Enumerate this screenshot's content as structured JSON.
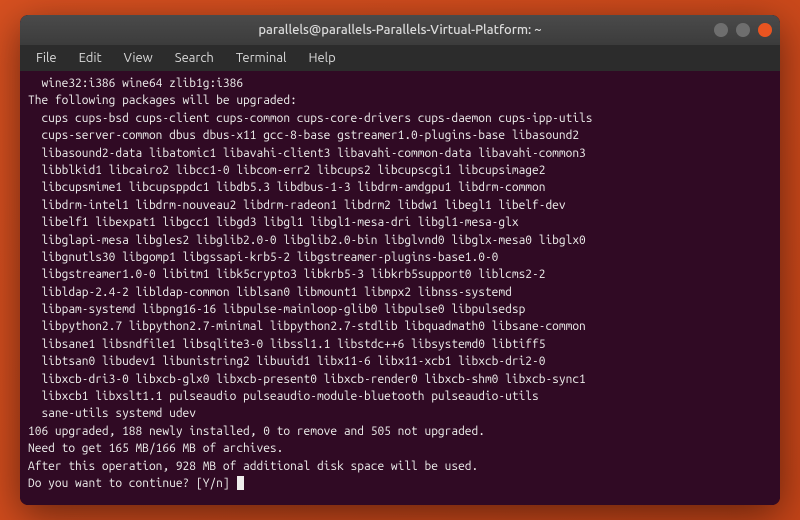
{
  "window": {
    "title": "parallels@parallels-Parallels-Virtual-Platform: ~"
  },
  "menubar": {
    "items": [
      "File",
      "Edit",
      "View",
      "Search",
      "Terminal",
      "Help"
    ]
  },
  "terminal": {
    "lines": [
      "  wine32:i386 wine64 zlib1g:i386",
      "The following packages will be upgraded:",
      "  cups cups-bsd cups-client cups-common cups-core-drivers cups-daemon cups-ipp-utils",
      "  cups-server-common dbus dbus-x11 gcc-8-base gstreamer1.0-plugins-base libasound2",
      "  libasound2-data libatomic1 libavahi-client3 libavahi-common-data libavahi-common3",
      "  libblkid1 libcairo2 libcc1-0 libcom-err2 libcups2 libcupscgi1 libcupsimage2",
      "  libcupsmime1 libcupsppdc1 libdb5.3 libdbus-1-3 libdrm-amdgpu1 libdrm-common",
      "  libdrm-intel1 libdrm-nouveau2 libdrm-radeon1 libdrm2 libdw1 libegl1 libelf-dev",
      "  libelf1 libexpat1 libgcc1 libgd3 libgl1 libgl1-mesa-dri libgl1-mesa-glx",
      "  libglapi-mesa libgles2 libglib2.0-0 libglib2.0-bin libglvnd0 libglx-mesa0 libglx0",
      "  libgnutls30 libgomp1 libgssapi-krb5-2 libgstreamer-plugins-base1.0-0",
      "  libgstreamer1.0-0 libitm1 libk5crypto3 libkrb5-3 libkrb5support0 liblcms2-2",
      "  libldap-2.4-2 libldap-common liblsan0 libmount1 libmpx2 libnss-systemd",
      "  libpam-systemd libpng16-16 libpulse-mainloop-glib0 libpulse0 libpulsedsp",
      "  libpython2.7 libpython2.7-minimal libpython2.7-stdlib libquadmath0 libsane-common",
      "  libsane1 libsndfile1 libsqlite3-0 libssl1.1 libstdc++6 libsystemd0 libtiff5",
      "  libtsan0 libudev1 libunistring2 libuuid1 libx11-6 libx11-xcb1 libxcb-dri2-0",
      "  libxcb-dri3-0 libxcb-glx0 libxcb-present0 libxcb-render0 libxcb-shm0 libxcb-sync1",
      "  libxcb1 libxslt1.1 pulseaudio pulseaudio-module-bluetooth pulseaudio-utils",
      "  sane-utils systemd udev",
      "106 upgraded, 188 newly installed, 0 to remove and 505 not upgraded.",
      "Need to get 165 MB/166 MB of archives.",
      "After this operation, 928 MB of additional disk space will be used.",
      "Do you want to continue? [Y/n] "
    ]
  }
}
